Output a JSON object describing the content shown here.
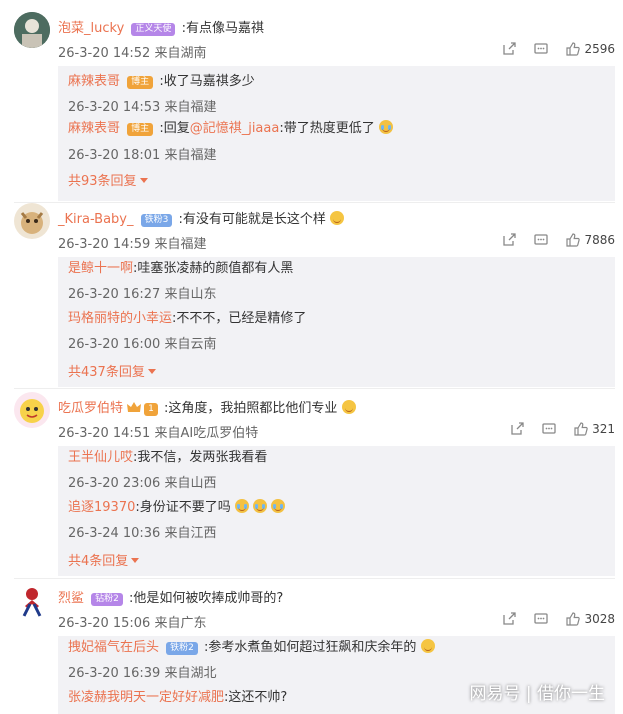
{
  "comments": [
    {
      "user": "泡菜_lucky",
      "badge": "正义天使",
      "text": ":有点像马嘉祺",
      "meta": "26-3-20 14:52 来自湖南",
      "likes": "2596",
      "replies": [
        {
          "user": "麻辣表哥",
          "badge": "博主",
          "text": ":收了马嘉祺多少",
          "meta": "26-3-20 14:53 来自福建"
        },
        {
          "user": "麻辣表哥",
          "badge": "博主",
          "text_prefix": ":回复",
          "mention": "@記憶祺_jiaaa",
          "text": ":带了热度更低了",
          "meta": "26-3-20 18:01 来自福建"
        }
      ],
      "more": "共93条回复"
    },
    {
      "user": "_Kira-Baby_",
      "badge": "铁粉3",
      "text": ":有没有可能就是长这个样",
      "meta": "26-3-20 14:59 来自福建",
      "likes": "7886",
      "replies": [
        {
          "user": "是鲸十一啊",
          "text": ":哇塞张凌赫的颜值都有人黑",
          "meta": "26-3-20 16:27 来自山东"
        },
        {
          "user": "玛格丽特的小幸运",
          "text": ":不不不，已经是精修了",
          "meta": "26-3-20 16:00 来自云南"
        }
      ],
      "more": "共437条回复"
    },
    {
      "user": "吃瓜罗伯特",
      "badge": "1",
      "text": ":这角度，我拍照都比他们专业",
      "meta": "26-3-20 14:51 来自AI吃瓜罗伯特",
      "likes": "321",
      "replies": [
        {
          "user": "王半仙儿哎",
          "text": ":我不信，发两张我看看",
          "meta": "26-3-20 23:06 来自山西"
        },
        {
          "user": "追逐19370",
          "text": ":身份证不要了吗",
          "meta": "26-3-24 10:36 来自江西"
        }
      ],
      "more": "共4条回复"
    },
    {
      "user": "烈鲨",
      "badge": "钻粉2",
      "text": ":他是如何被吹捧成帅哥的?",
      "meta": "26-3-20 15:06 来自广东",
      "likes": "3028",
      "replies": [
        {
          "user": "拽妃福气在后头",
          "badge": "铁粉2",
          "text": ":参考水煮鱼如何超过狂飙和庆余年的",
          "meta": "26-3-20 16:39 来自湖北"
        },
        {
          "user": "张凌赫我明天一定好好减肥",
          "text": ":这还不帅?",
          "meta": ""
        }
      ]
    }
  ],
  "watermark": "网易号 | 借你一生",
  "colors": {
    "username": "#eb7350",
    "reply_bg": "#f2f2f5"
  }
}
